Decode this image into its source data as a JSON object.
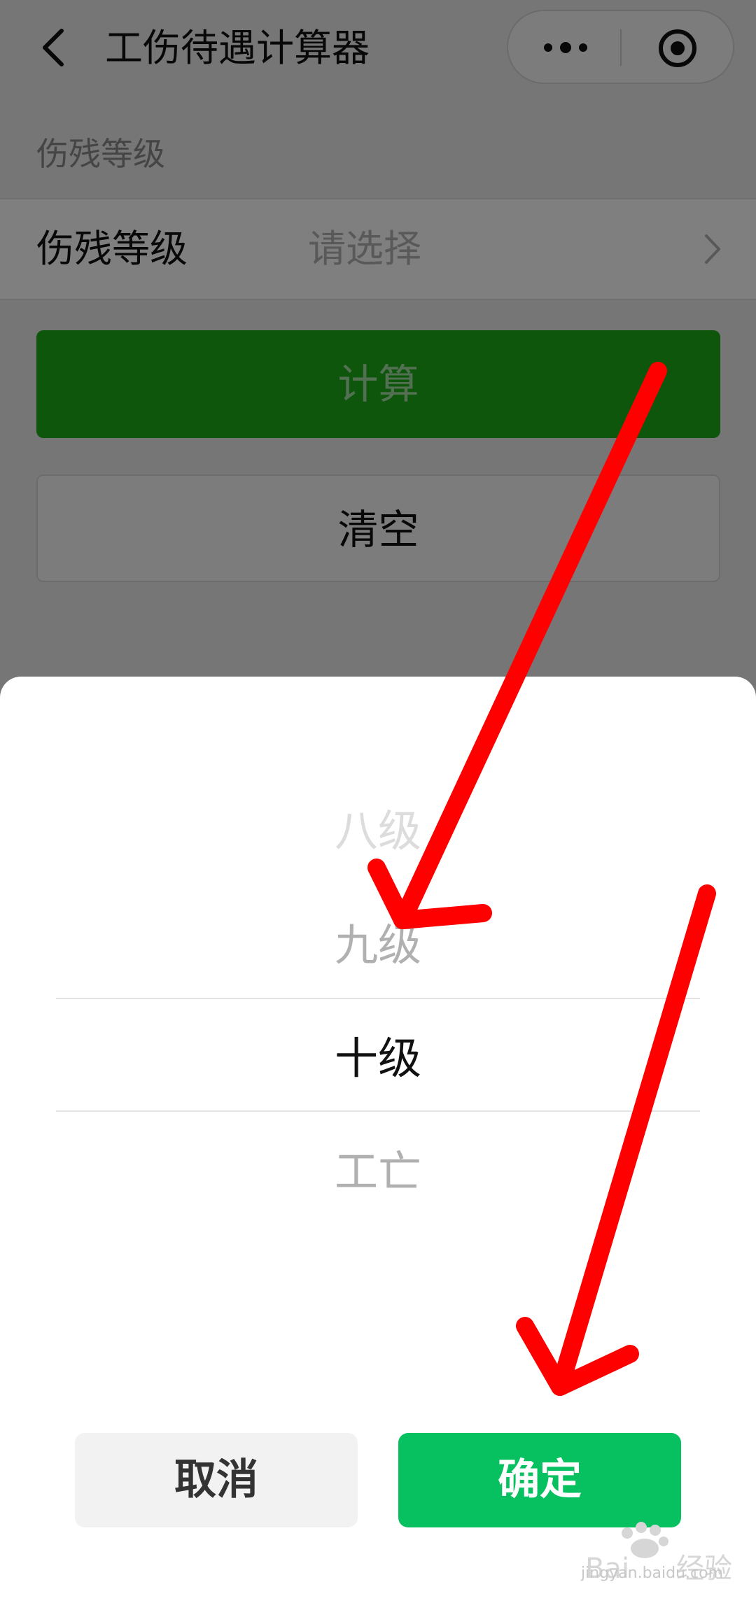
{
  "nav": {
    "title": "工伤待遇计算器",
    "back_icon": "chevron-left-icon",
    "more_icon": "more-dots-icon",
    "target_icon": "record-circle-icon"
  },
  "form": {
    "section_label": "伤残等级",
    "row_label": "伤残等级",
    "row_placeholder": "请选择",
    "row_arrow_icon": "chevron-right-icon"
  },
  "buttons": {
    "calculate": "计算",
    "clear": "清空"
  },
  "picker": {
    "items": [
      "八级",
      "九级",
      "十级",
      "工亡"
    ],
    "selected": "十级",
    "cancel": "取消",
    "confirm": "确定"
  },
  "colors": {
    "primary_green": "#07c160",
    "calc_green": "#1aad19",
    "arrow_red": "#ff0000"
  },
  "watermark": {
    "brand": "Baidu经验",
    "url": "jingyan.baidu.com"
  }
}
